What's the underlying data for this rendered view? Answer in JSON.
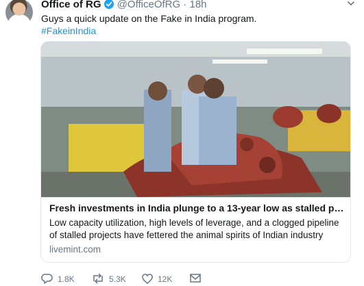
{
  "tweet": {
    "author_name": "Office of RG",
    "handle": "@OfficeOfRG",
    "separator": "·",
    "time": "18h",
    "text": "Guys a quick update on the Fake in India program.",
    "hashtag": "#FakeinIndia"
  },
  "card": {
    "title": "Fresh investments in India plunge to a 13-year low as stalled proj...",
    "description": "Low capacity utilization, high levels of leverage, and a clogged pipeline of stalled projects have fettered the animal spirits of Indian industry",
    "domain": "livemint.com"
  },
  "actions": {
    "replies": "1.8K",
    "retweets": "5.3K",
    "likes": "12K"
  },
  "icons": [
    "verified-badge-icon",
    "chevron-down-icon",
    "reply-icon",
    "retweet-icon",
    "like-icon",
    "message-icon"
  ],
  "colors": {
    "link": "#1b95e0",
    "muted": "#657786",
    "verified": "#1da1f2"
  }
}
